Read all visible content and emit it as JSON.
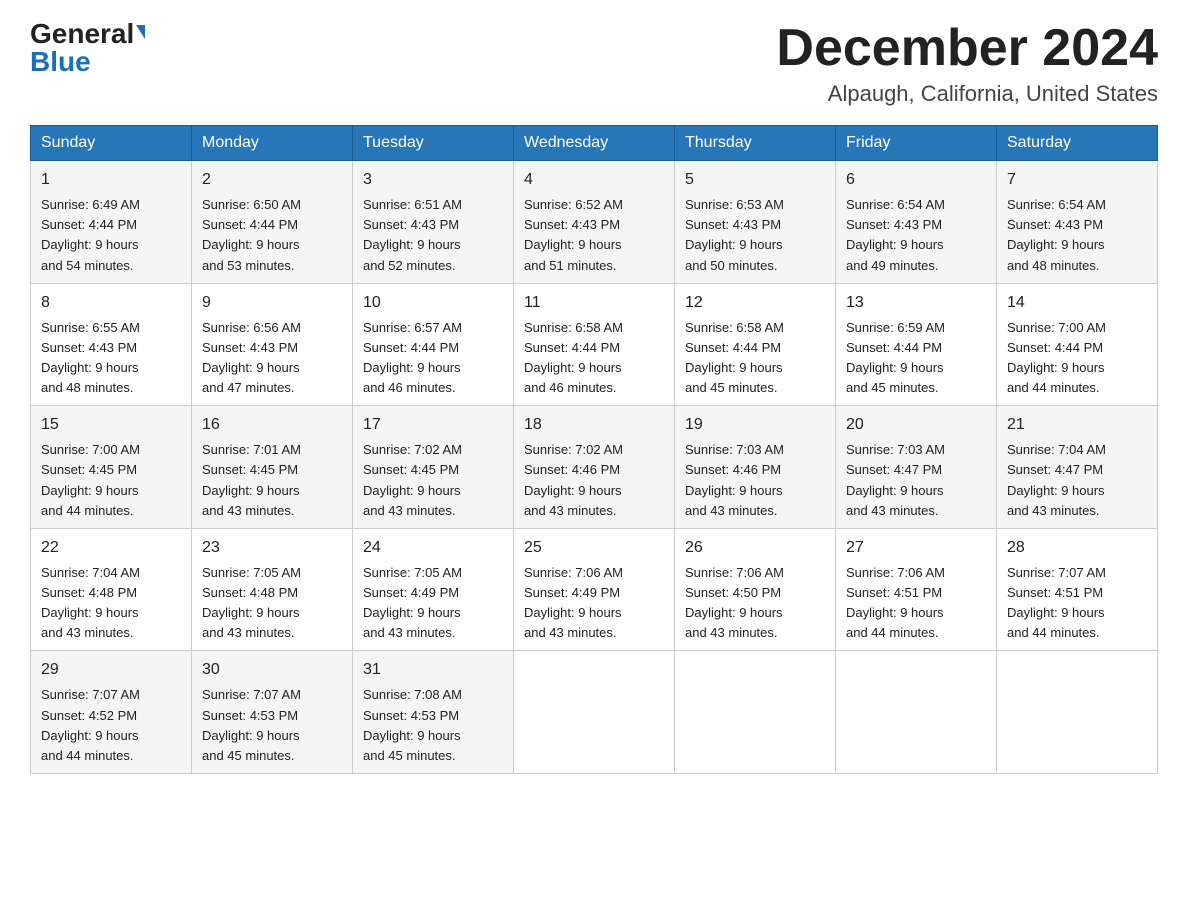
{
  "header": {
    "logo_general": "General",
    "logo_blue": "Blue",
    "month_title": "December 2024",
    "location": "Alpaugh, California, United States"
  },
  "days_of_week": [
    "Sunday",
    "Monday",
    "Tuesday",
    "Wednesday",
    "Thursday",
    "Friday",
    "Saturday"
  ],
  "weeks": [
    [
      {
        "day": "1",
        "sunrise": "6:49 AM",
        "sunset": "4:44 PM",
        "daylight": "9 hours and 54 minutes."
      },
      {
        "day": "2",
        "sunrise": "6:50 AM",
        "sunset": "4:44 PM",
        "daylight": "9 hours and 53 minutes."
      },
      {
        "day": "3",
        "sunrise": "6:51 AM",
        "sunset": "4:43 PM",
        "daylight": "9 hours and 52 minutes."
      },
      {
        "day": "4",
        "sunrise": "6:52 AM",
        "sunset": "4:43 PM",
        "daylight": "9 hours and 51 minutes."
      },
      {
        "day": "5",
        "sunrise": "6:53 AM",
        "sunset": "4:43 PM",
        "daylight": "9 hours and 50 minutes."
      },
      {
        "day": "6",
        "sunrise": "6:54 AM",
        "sunset": "4:43 PM",
        "daylight": "9 hours and 49 minutes."
      },
      {
        "day": "7",
        "sunrise": "6:54 AM",
        "sunset": "4:43 PM",
        "daylight": "9 hours and 48 minutes."
      }
    ],
    [
      {
        "day": "8",
        "sunrise": "6:55 AM",
        "sunset": "4:43 PM",
        "daylight": "9 hours and 48 minutes."
      },
      {
        "day": "9",
        "sunrise": "6:56 AM",
        "sunset": "4:43 PM",
        "daylight": "9 hours and 47 minutes."
      },
      {
        "day": "10",
        "sunrise": "6:57 AM",
        "sunset": "4:44 PM",
        "daylight": "9 hours and 46 minutes."
      },
      {
        "day": "11",
        "sunrise": "6:58 AM",
        "sunset": "4:44 PM",
        "daylight": "9 hours and 46 minutes."
      },
      {
        "day": "12",
        "sunrise": "6:58 AM",
        "sunset": "4:44 PM",
        "daylight": "9 hours and 45 minutes."
      },
      {
        "day": "13",
        "sunrise": "6:59 AM",
        "sunset": "4:44 PM",
        "daylight": "9 hours and 45 minutes."
      },
      {
        "day": "14",
        "sunrise": "7:00 AM",
        "sunset": "4:44 PM",
        "daylight": "9 hours and 44 minutes."
      }
    ],
    [
      {
        "day": "15",
        "sunrise": "7:00 AM",
        "sunset": "4:45 PM",
        "daylight": "9 hours and 44 minutes."
      },
      {
        "day": "16",
        "sunrise": "7:01 AM",
        "sunset": "4:45 PM",
        "daylight": "9 hours and 43 minutes."
      },
      {
        "day": "17",
        "sunrise": "7:02 AM",
        "sunset": "4:45 PM",
        "daylight": "9 hours and 43 minutes."
      },
      {
        "day": "18",
        "sunrise": "7:02 AM",
        "sunset": "4:46 PM",
        "daylight": "9 hours and 43 minutes."
      },
      {
        "day": "19",
        "sunrise": "7:03 AM",
        "sunset": "4:46 PM",
        "daylight": "9 hours and 43 minutes."
      },
      {
        "day": "20",
        "sunrise": "7:03 AM",
        "sunset": "4:47 PM",
        "daylight": "9 hours and 43 minutes."
      },
      {
        "day": "21",
        "sunrise": "7:04 AM",
        "sunset": "4:47 PM",
        "daylight": "9 hours and 43 minutes."
      }
    ],
    [
      {
        "day": "22",
        "sunrise": "7:04 AM",
        "sunset": "4:48 PM",
        "daylight": "9 hours and 43 minutes."
      },
      {
        "day": "23",
        "sunrise": "7:05 AM",
        "sunset": "4:48 PM",
        "daylight": "9 hours and 43 minutes."
      },
      {
        "day": "24",
        "sunrise": "7:05 AM",
        "sunset": "4:49 PM",
        "daylight": "9 hours and 43 minutes."
      },
      {
        "day": "25",
        "sunrise": "7:06 AM",
        "sunset": "4:49 PM",
        "daylight": "9 hours and 43 minutes."
      },
      {
        "day": "26",
        "sunrise": "7:06 AM",
        "sunset": "4:50 PM",
        "daylight": "9 hours and 43 minutes."
      },
      {
        "day": "27",
        "sunrise": "7:06 AM",
        "sunset": "4:51 PM",
        "daylight": "9 hours and 44 minutes."
      },
      {
        "day": "28",
        "sunrise": "7:07 AM",
        "sunset": "4:51 PM",
        "daylight": "9 hours and 44 minutes."
      }
    ],
    [
      {
        "day": "29",
        "sunrise": "7:07 AM",
        "sunset": "4:52 PM",
        "daylight": "9 hours and 44 minutes."
      },
      {
        "day": "30",
        "sunrise": "7:07 AM",
        "sunset": "4:53 PM",
        "daylight": "9 hours and 45 minutes."
      },
      {
        "day": "31",
        "sunrise": "7:08 AM",
        "sunset": "4:53 PM",
        "daylight": "9 hours and 45 minutes."
      },
      null,
      null,
      null,
      null
    ]
  ],
  "labels": {
    "sunrise": "Sunrise:",
    "sunset": "Sunset:",
    "daylight": "Daylight:"
  }
}
